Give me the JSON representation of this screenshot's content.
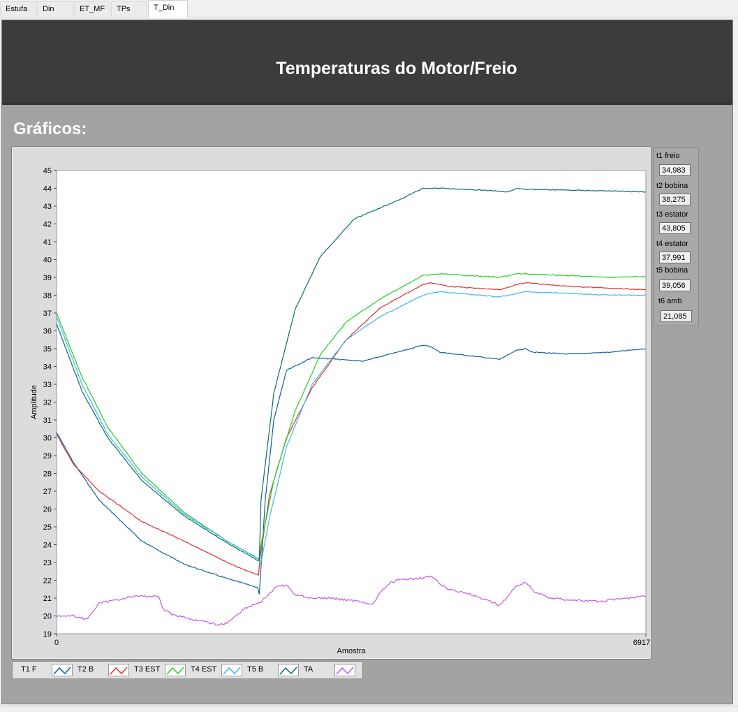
{
  "tabs": [
    {
      "label": "Estufa",
      "active": false
    },
    {
      "label": "Din",
      "active": false
    },
    {
      "label": "ET_MF",
      "active": false
    },
    {
      "label": "TPs",
      "active": false
    },
    {
      "label": "T_Din",
      "active": true
    }
  ],
  "header": {
    "title": "Temperaturas do Motor/Freio"
  },
  "section": {
    "title": "Gráficos:"
  },
  "readouts": [
    {
      "label": "t1 freio",
      "value": "34,983"
    },
    {
      "label": "t2 bobina",
      "value": "38,275"
    },
    {
      "label": "t3 estator",
      "value": "43,805"
    },
    {
      "label": "t4 estator",
      "value": "37,991"
    },
    {
      "label": "t5 bobina",
      "value": "39,056"
    },
    {
      "label": "t6 amb",
      "value": "21,085"
    }
  ],
  "legend": [
    {
      "label": "T1 F",
      "color": "#0d5fa3"
    },
    {
      "label": "T2 B",
      "color": "#e03030"
    },
    {
      "label": "T3 EST",
      "color": "#22d022"
    },
    {
      "label": "T4 EST",
      "color": "#3fb6ef"
    },
    {
      "label": "T5 B",
      "color": "#0a6c74"
    },
    {
      "label": "TA",
      "color": "#c05ae6"
    }
  ],
  "chart_data": {
    "type": "line",
    "xlabel": "Amostra",
    "ylabel": "Amplitude",
    "xlim": [
      0,
      6917
    ],
    "ylim": [
      19,
      45
    ],
    "x_ticks": [
      0,
      6917
    ],
    "y_ticks": [
      19,
      20,
      21,
      22,
      23,
      24,
      25,
      26,
      27,
      28,
      29,
      30,
      31,
      32,
      33,
      34,
      35,
      36,
      37,
      38,
      39,
      40,
      41,
      42,
      43,
      44,
      45
    ],
    "grid": false,
    "series": [
      {
        "name": "T1 F",
        "color": "#0d5fa3",
        "x": [
          0,
          200,
          500,
          1000,
          1500,
          2000,
          2360,
          2380,
          2450,
          2550,
          2700,
          3000,
          3600,
          4000,
          4300,
          4400,
          4500,
          5200,
          5400,
          5500,
          5600,
          6000,
          6500,
          6917
        ],
        "y": [
          30.3,
          28.6,
          26.5,
          24.2,
          22.9,
          22.1,
          21.6,
          21.2,
          26.5,
          31.0,
          33.8,
          34.5,
          34.3,
          34.8,
          35.2,
          35.1,
          34.8,
          34.4,
          34.9,
          35.0,
          34.8,
          34.7,
          34.8,
          35.0
        ]
      },
      {
        "name": "T2 B",
        "color": "#e03030",
        "x": [
          0,
          200,
          500,
          1000,
          1500,
          2000,
          2300,
          2370,
          2390,
          2500,
          2700,
          3000,
          3400,
          3800,
          4300,
          4400,
          4600,
          5200,
          5400,
          5500,
          6000,
          6500,
          6917
        ],
        "y": [
          30.2,
          28.5,
          27.0,
          25.3,
          24.2,
          23.0,
          22.4,
          22.3,
          23.3,
          26.8,
          30.0,
          32.8,
          35.5,
          37.3,
          38.6,
          38.7,
          38.5,
          38.3,
          38.6,
          38.7,
          38.5,
          38.4,
          38.3
        ]
      },
      {
        "name": "T3 EST",
        "color": "#22d022",
        "x": [
          0,
          300,
          600,
          1000,
          1500,
          2000,
          2370,
          2380,
          2400,
          2550,
          2800,
          3100,
          3400,
          3800,
          4300,
          4500,
          5200,
          5400,
          5500,
          6000,
          6500,
          6917
        ],
        "y": [
          37.0,
          33.4,
          30.6,
          28.0,
          25.8,
          24.2,
          23.2,
          23.1,
          24.0,
          27.6,
          31.5,
          34.7,
          36.5,
          37.8,
          39.1,
          39.2,
          39.0,
          39.2,
          39.2,
          39.1,
          39.0,
          39.05
        ]
      },
      {
        "name": "T4 EST",
        "color": "#3fb6ef",
        "x": [
          0,
          300,
          600,
          1000,
          1500,
          2000,
          2380,
          2400,
          2500,
          2700,
          3000,
          3400,
          3800,
          4300,
          4500,
          5200,
          5400,
          5500,
          6000,
          6500,
          6917
        ],
        "y": [
          36.8,
          33.0,
          30.2,
          27.8,
          25.7,
          24.2,
          23.2,
          23.0,
          25.5,
          29.5,
          33.0,
          35.5,
          36.8,
          38.0,
          38.2,
          37.9,
          38.1,
          38.2,
          38.1,
          38.0,
          38.0
        ]
      },
      {
        "name": "T5 B",
        "color": "#0a6c74",
        "x": [
          0,
          300,
          600,
          1000,
          1500,
          2000,
          2370,
          2380,
          2400,
          2550,
          2800,
          3100,
          3500,
          4000,
          4300,
          4500,
          5000,
          5300,
          5400,
          5500,
          6000,
          6500,
          6917
        ],
        "y": [
          36.4,
          32.6,
          30.0,
          27.6,
          25.6,
          24.1,
          23.1,
          23.2,
          26.5,
          32.5,
          37.2,
          40.2,
          42.3,
          43.3,
          44.0,
          44.0,
          43.9,
          43.8,
          44.0,
          43.95,
          43.9,
          43.85,
          43.8
        ]
      },
      {
        "name": "TA",
        "color": "#c05ae6",
        "x": [
          0,
          200,
          350,
          500,
          900,
          1200,
          1250,
          1350,
          1600,
          1900,
          2000,
          2200,
          2400,
          2600,
          2700,
          2800,
          3000,
          3200,
          3600,
          3700,
          3800,
          3900,
          4000,
          4400,
          4500,
          4600,
          4800,
          5200,
          5300,
          5400,
          5500,
          5600,
          5800,
          6000,
          6400,
          6500,
          6917
        ],
        "y": [
          20.0,
          20.0,
          19.8,
          20.7,
          21.1,
          21.1,
          20.4,
          20.1,
          19.8,
          19.5,
          19.6,
          20.4,
          20.8,
          21.7,
          21.7,
          21.2,
          21.0,
          21.0,
          20.8,
          20.6,
          21.3,
          21.8,
          22.0,
          22.2,
          21.8,
          21.5,
          21.3,
          20.6,
          21.1,
          21.7,
          21.9,
          21.4,
          21.0,
          20.9,
          20.8,
          20.9,
          21.1
        ]
      }
    ]
  }
}
